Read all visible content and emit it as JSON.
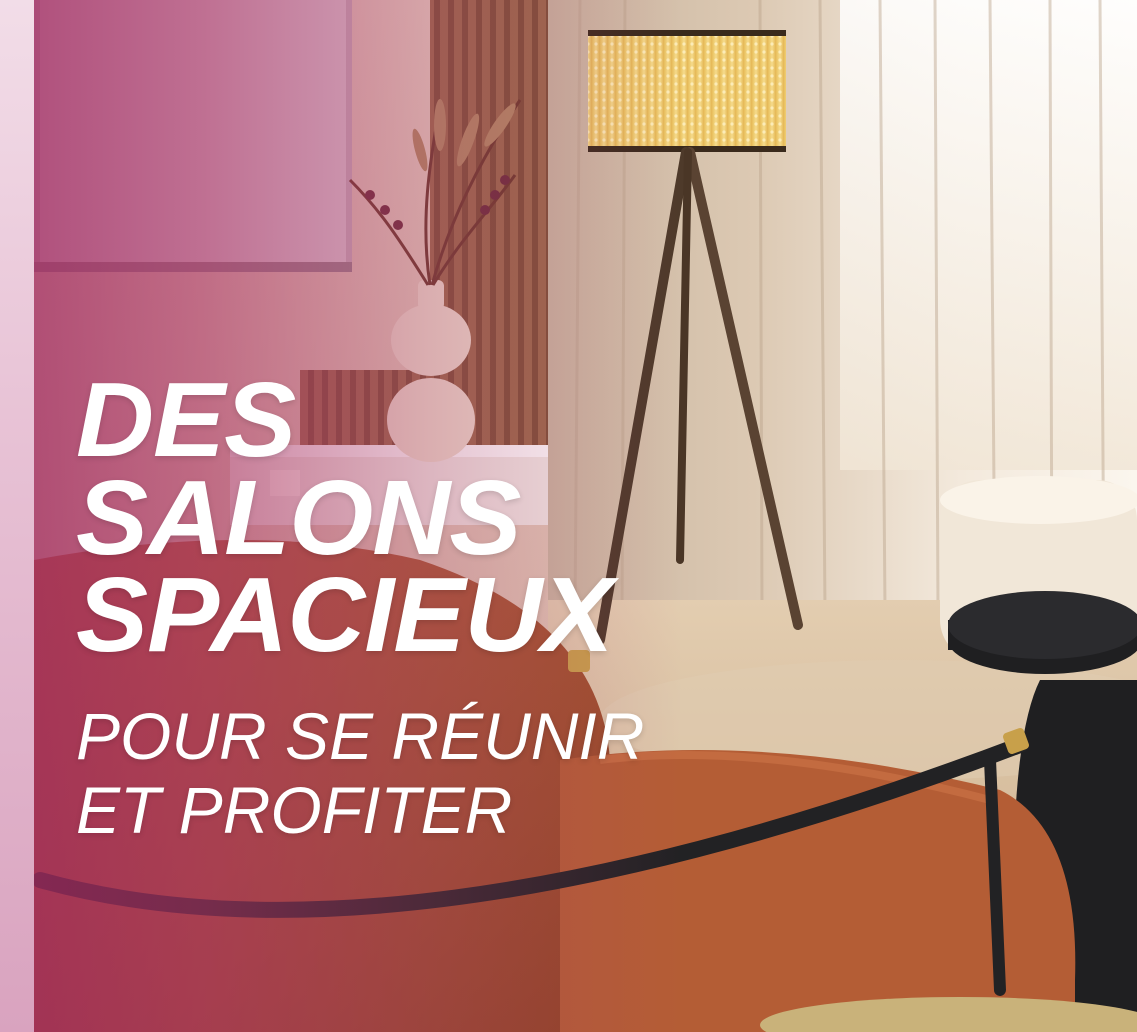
{
  "headline": {
    "lines": [
      "DES",
      "SALONS",
      "SPACIEUX"
    ]
  },
  "subline": {
    "lines": [
      "POUR SE RÉUNIR",
      "ET PROFITER"
    ]
  },
  "colors": {
    "overlay": "#a0285f",
    "text": "#ffffff",
    "armchair": "#b25a33",
    "lampshade": "#f1d27a",
    "side_table": "#1f1f21"
  },
  "icons": []
}
